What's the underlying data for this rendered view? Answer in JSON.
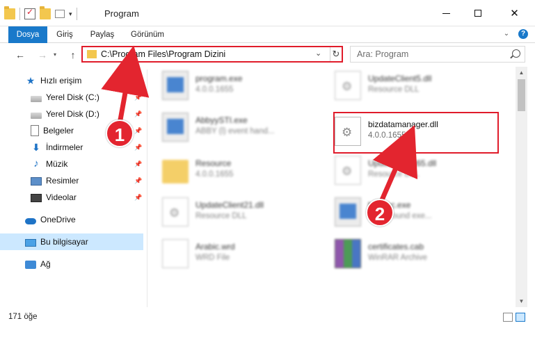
{
  "window": {
    "title": "Program",
    "minimize": "",
    "maximize": "",
    "close": "✕"
  },
  "ribbon": {
    "tabs": [
      "Dosya",
      "Giriş",
      "Paylaş",
      "Görünüm"
    ],
    "help": "?"
  },
  "nav": {
    "back": "←",
    "forward": "→",
    "up": "↑",
    "address": "C:\\Program Files\\Program Dizini",
    "refresh": "↻",
    "search_placeholder": "Ara: Program"
  },
  "sidebar": {
    "quick_access": "Hızlı erişim",
    "items": [
      {
        "label": "Yerel Disk (C:)",
        "icon": "disk-icon"
      },
      {
        "label": "Yerel Disk (D:)",
        "icon": "disk-icon"
      },
      {
        "label": "Belgeler",
        "icon": "documents-icon"
      },
      {
        "label": "İndirmeler",
        "icon": "downloads-icon"
      },
      {
        "label": "Müzik",
        "icon": "music-icon"
      },
      {
        "label": "Resimler",
        "icon": "pictures-icon"
      },
      {
        "label": "Videolar",
        "icon": "videos-icon"
      }
    ],
    "onedrive": "OneDrive",
    "this_pc": "Bu bilgisayar",
    "network": "Ağ"
  },
  "files": [
    {
      "name": "program.exe",
      "sub": "4.0.0.1655",
      "type": "app"
    },
    {
      "name": "UpdateClient5.dll",
      "sub": "Resource DLL",
      "type": "dll"
    },
    {
      "name": "AbbyySTI.exe",
      "sub": "ABBY (l) event hand...",
      "type": "app"
    },
    {
      "name": "bizdatamanager.dll",
      "sub": "4.0.0.1655",
      "type": "dll"
    },
    {
      "name": "Resource",
      "sub": "4.0.0.1655",
      "type": "folder"
    },
    {
      "name": "UpdateClient65.dll",
      "sub": "Resource DLL",
      "type": "dll"
    },
    {
      "name": "UpdateClient21.dll",
      "sub": "Resource DLL",
      "type": "dll"
    },
    {
      "name": "bgexec.exe",
      "sub": "background exe...",
      "type": "app"
    },
    {
      "name": "Arabic.wrd",
      "sub": "WRD File",
      "type": "page"
    },
    {
      "name": "certificates.cab",
      "sub": "WinRAR Archive",
      "type": "rar"
    }
  ],
  "status": {
    "count": "171 öğe"
  },
  "annotations": {
    "step1": "1",
    "step2": "2",
    "color": "#e3252f"
  },
  "colors": {
    "accent": "#1979ca",
    "selected_bg": "#cce8ff",
    "highlight": "#e01b2a"
  }
}
